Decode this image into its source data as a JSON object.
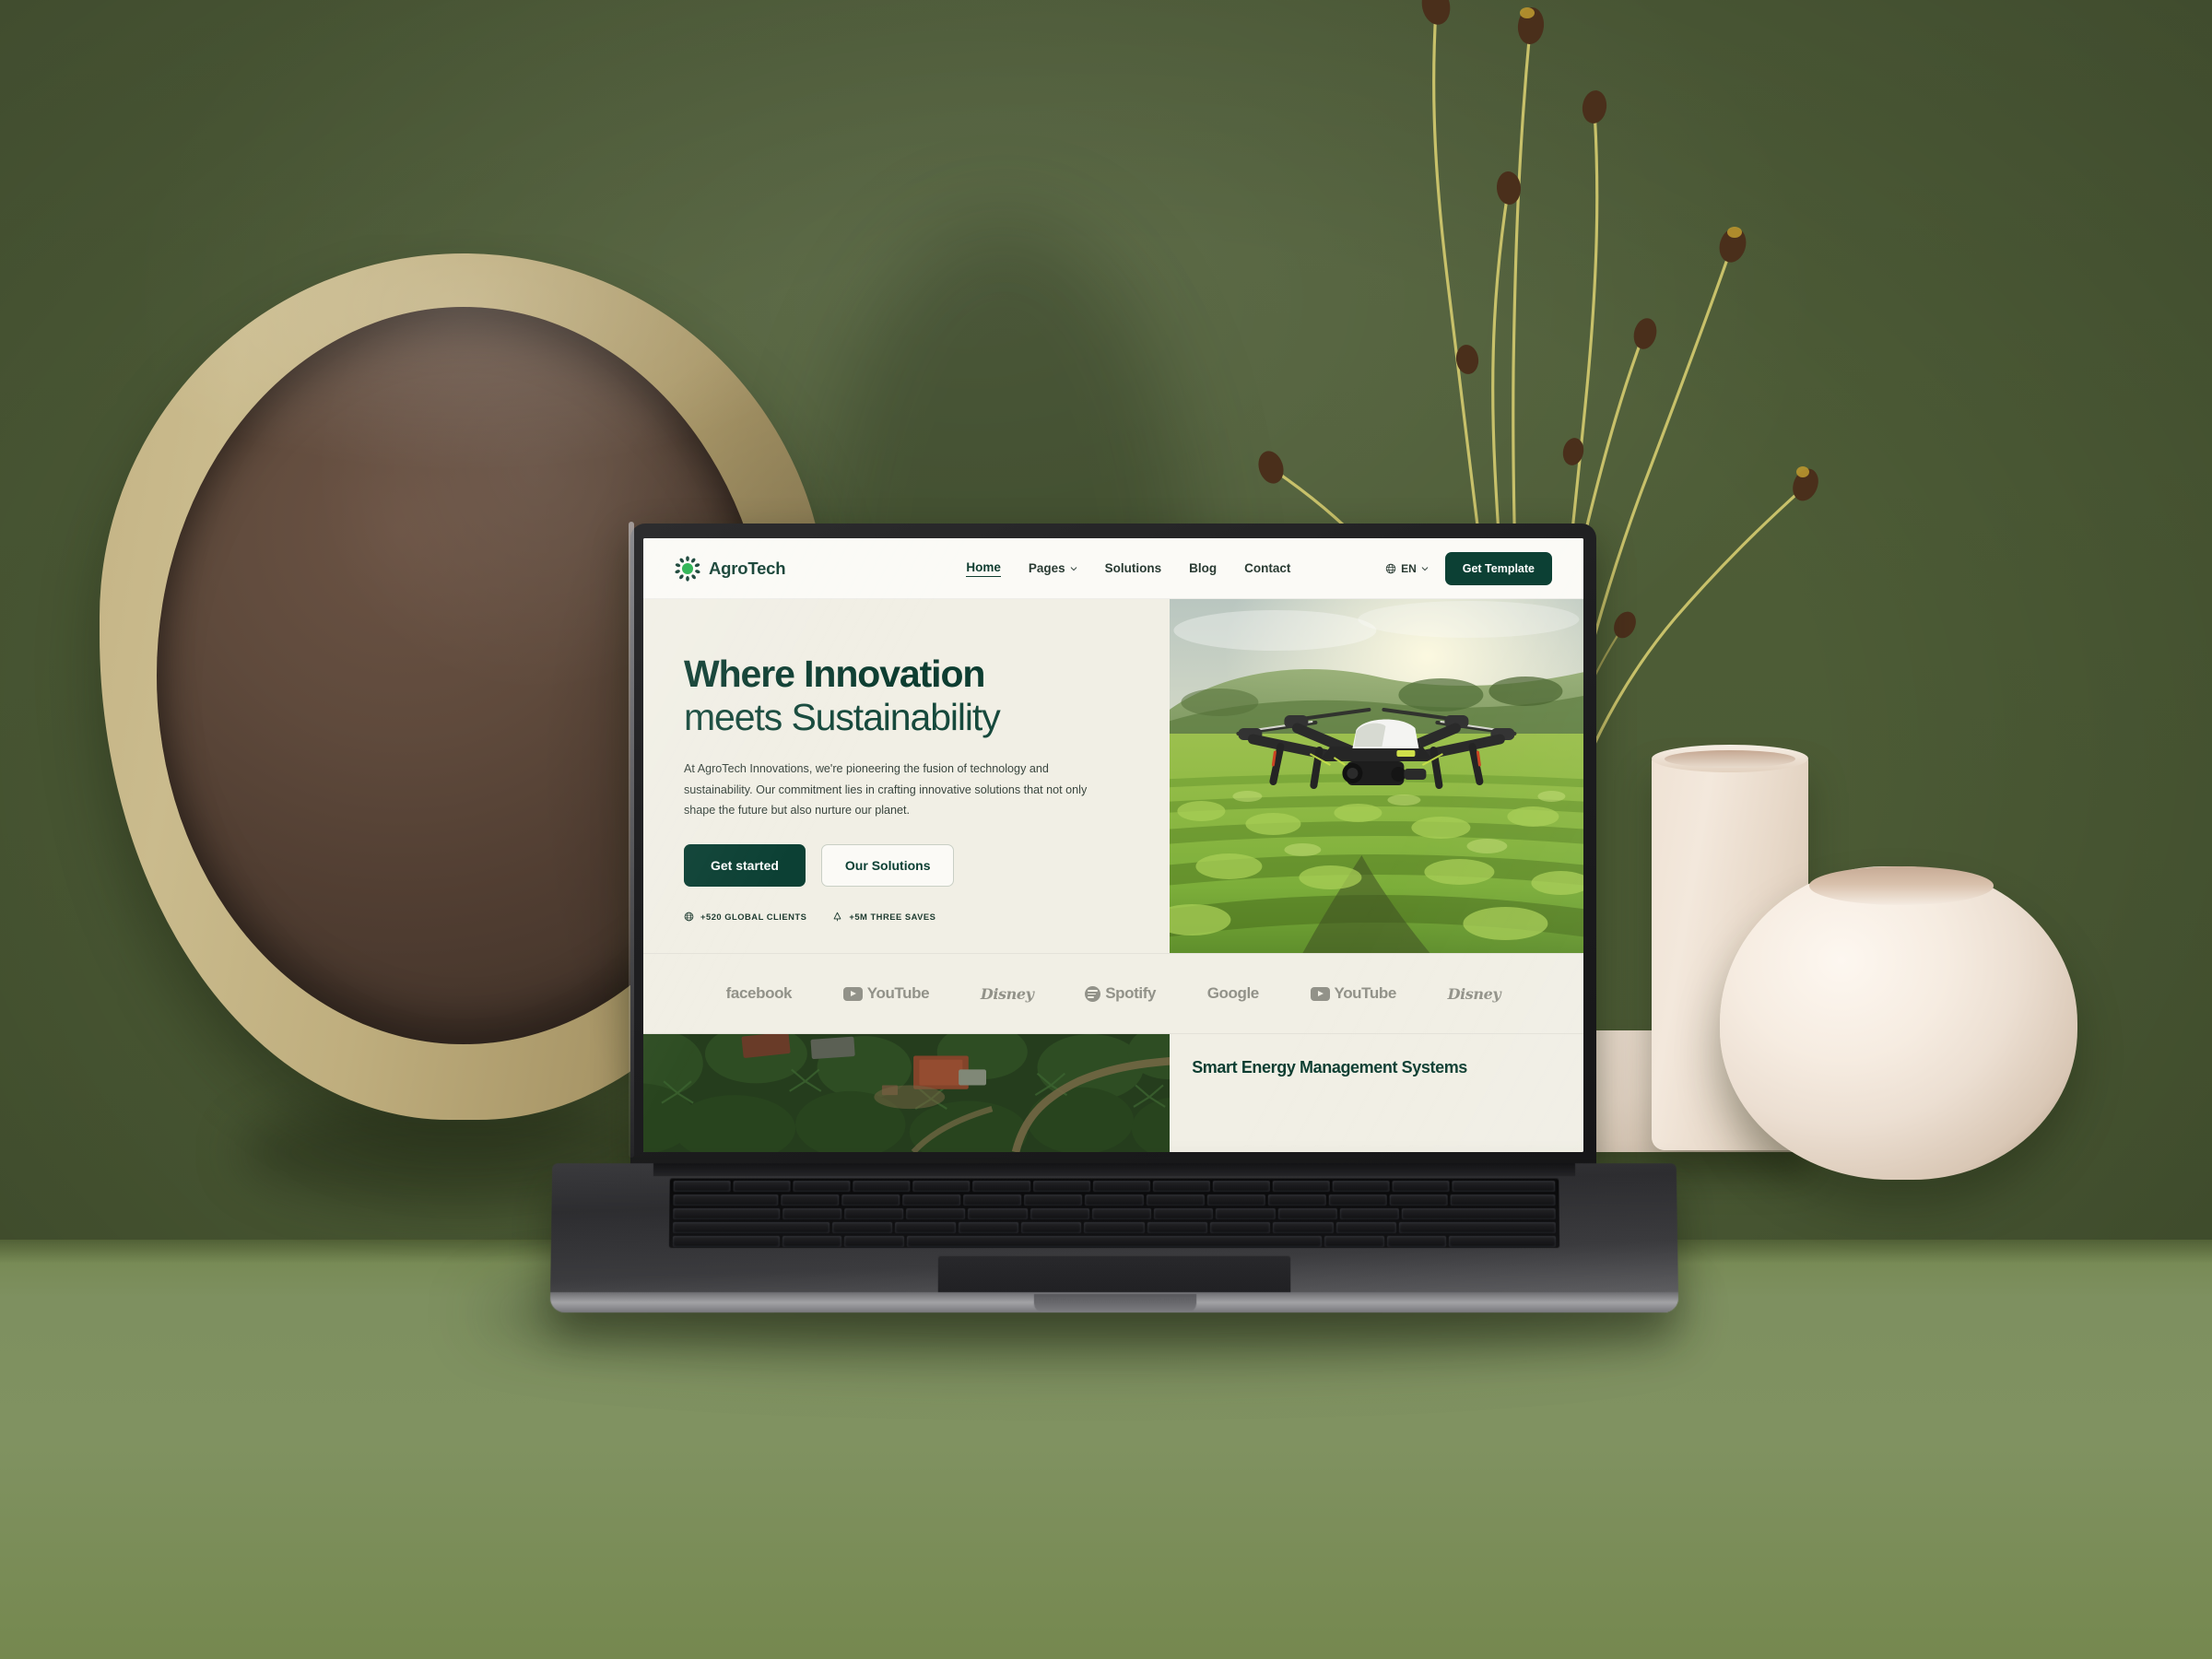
{
  "scene": {
    "backdrop_color": "#4d5c36",
    "floor_color": "#7e9060",
    "props": [
      {
        "name": "concrete-bowl",
        "description": "large beige concrete planter bowl"
      },
      {
        "name": "tall-ceramic-vase",
        "description": "cream L-shaped tube vase with dried stems"
      },
      {
        "name": "round-ceramic-vase",
        "description": "cream round disc vase"
      },
      {
        "name": "dried-stems",
        "description": "pale dried flower stems with dark seed heads"
      }
    ]
  },
  "device": {
    "name": "laptop",
    "body_color": "#2d2d30",
    "screen_bg": "#f1efe5"
  },
  "site": {
    "navbar": {
      "brand": {
        "name": "AgroTech",
        "mark": "sun-leaf-icon",
        "mark_color": "#22b14c",
        "petal_color": "#0f3d30"
      },
      "links": [
        {
          "label": "Home",
          "active": true,
          "has_dropdown": false
        },
        {
          "label": "Pages",
          "active": false,
          "has_dropdown": true
        },
        {
          "label": "Solutions",
          "active": false,
          "has_dropdown": false
        },
        {
          "label": "Blog",
          "active": false,
          "has_dropdown": false
        },
        {
          "label": "Contact",
          "active": false,
          "has_dropdown": false
        }
      ],
      "language": {
        "code": "EN",
        "icon": "globe-icon",
        "chevron": "chevron-down-icon"
      },
      "cta_label": "Get Template"
    },
    "hero": {
      "title_line1": "Where Innovation",
      "title_line2": "meets Sustainability",
      "paragraph": "At AgroTech Innovations, we're pioneering the fusion of technology and sustainability. Our commitment lies in crafting innovative solutions that not only shape the future but also nurture our planet.",
      "primary_button": "Get started",
      "secondary_button": "Our Solutions",
      "stats": [
        {
          "icon": "globe-icon",
          "label": "+520 GLOBAL CLIENTS"
        },
        {
          "icon": "tree-icon",
          "label": "+5M THREE SAVES"
        }
      ],
      "image_alt": "agricultural drone flying over a green crop field at golden hour"
    },
    "client_logos": [
      {
        "name": "facebook",
        "style": "text"
      },
      {
        "name": "YouTube",
        "style": "icon-text"
      },
      {
        "name": "Disney",
        "style": "script"
      },
      {
        "name": "Spotify",
        "style": "icon-text"
      },
      {
        "name": "Google",
        "style": "text"
      },
      {
        "name": "YouTube",
        "style": "icon-text"
      },
      {
        "name": "Disney",
        "style": "script"
      }
    ],
    "bottom_section": {
      "image_alt": "aerial view of a tropical village with red-roofed houses among dense trees",
      "title": "Smart Energy Management Systems"
    },
    "colors": {
      "brand_dark_green": "#0c4034",
      "brand_bright_green": "#22b14c",
      "page_bg": "#f1efe5",
      "nav_bg": "#fbfaf6",
      "body_text": "#39453e"
    }
  }
}
